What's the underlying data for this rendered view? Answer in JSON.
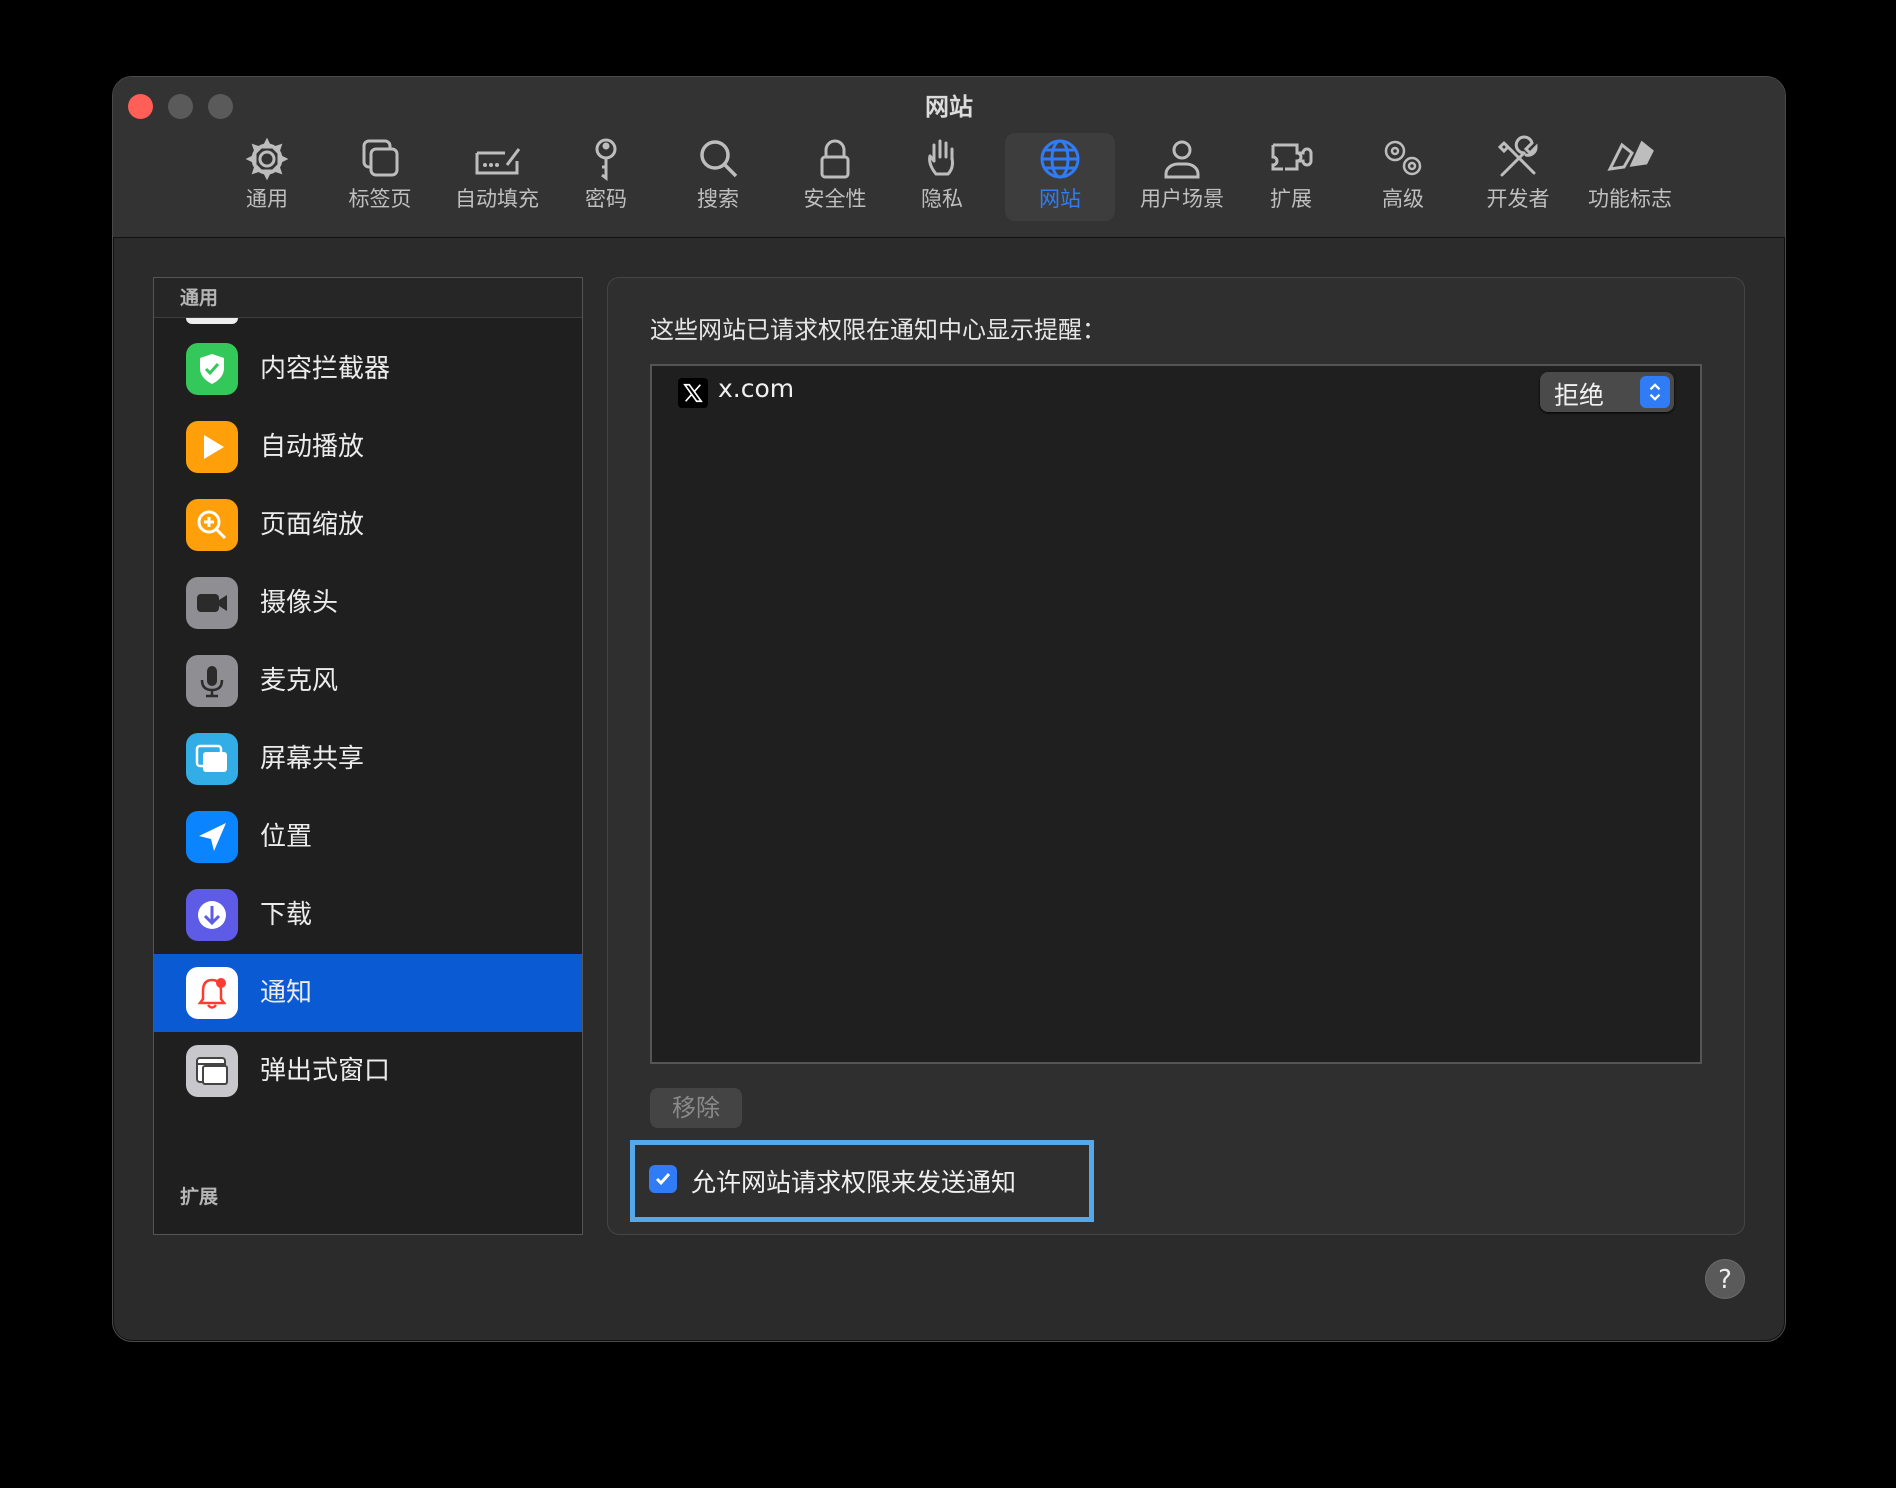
{
  "window": {
    "title": "网站"
  },
  "toolbar": {
    "items": [
      {
        "label": "通用",
        "icon": "gear-icon"
      },
      {
        "label": "标签页",
        "icon": "tabs-icon"
      },
      {
        "label": "自动填充",
        "icon": "autofill-icon"
      },
      {
        "label": "密码",
        "icon": "key-icon"
      },
      {
        "label": "搜索",
        "icon": "search-icon"
      },
      {
        "label": "安全性",
        "icon": "lock-icon"
      },
      {
        "label": "隐私",
        "icon": "hand-icon"
      },
      {
        "label": "网站",
        "icon": "globe-icon",
        "active": true
      },
      {
        "label": "用户场景",
        "icon": "person-icon"
      },
      {
        "label": "扩展",
        "icon": "puzzle-icon"
      },
      {
        "label": "高级",
        "icon": "gears-icon"
      },
      {
        "label": "开发者",
        "icon": "tools-icon"
      },
      {
        "label": "功能标志",
        "icon": "flags-icon"
      }
    ]
  },
  "sidebar": {
    "header": "通用",
    "items": [
      {
        "label": "内容拦截器",
        "icon": "shield-check-icon",
        "color": "#34c759"
      },
      {
        "label": "自动播放",
        "icon": "play-icon",
        "color": "#ff9f0a"
      },
      {
        "label": "页面缩放",
        "icon": "zoom-icon",
        "color": "#ff9f0a"
      },
      {
        "label": "摄像头",
        "icon": "camera-icon",
        "color": "#8e8e93"
      },
      {
        "label": "麦克风",
        "icon": "microphone-icon",
        "color": "#8e8e93"
      },
      {
        "label": "屏幕共享",
        "icon": "screen-share-icon",
        "color": "#32ade6"
      },
      {
        "label": "位置",
        "icon": "location-arrow-icon",
        "color": "#0a84ff"
      },
      {
        "label": "下载",
        "icon": "download-icon",
        "color": "#5e5ce6"
      },
      {
        "label": "通知",
        "icon": "bell-icon",
        "color": "#ffffff",
        "selected": true
      },
      {
        "label": "弹出式窗口",
        "icon": "popup-window-icon",
        "color": "#8e8e93"
      }
    ],
    "footer": "扩展"
  },
  "content": {
    "title": "这些网站已请求权限在通知中心显示提醒：",
    "sites": [
      {
        "name": "x.com",
        "icon": "x-logo-icon",
        "permission": "拒绝"
      }
    ],
    "remove_label": "移除",
    "allow_label": "允许网站请求权限来发送通知",
    "allow_checked": true
  },
  "help": {
    "label": "?"
  },
  "colors": {
    "accent": "#2f7cf6",
    "selection": "#0a5ad4",
    "focus_ring": "#55a9ea"
  }
}
